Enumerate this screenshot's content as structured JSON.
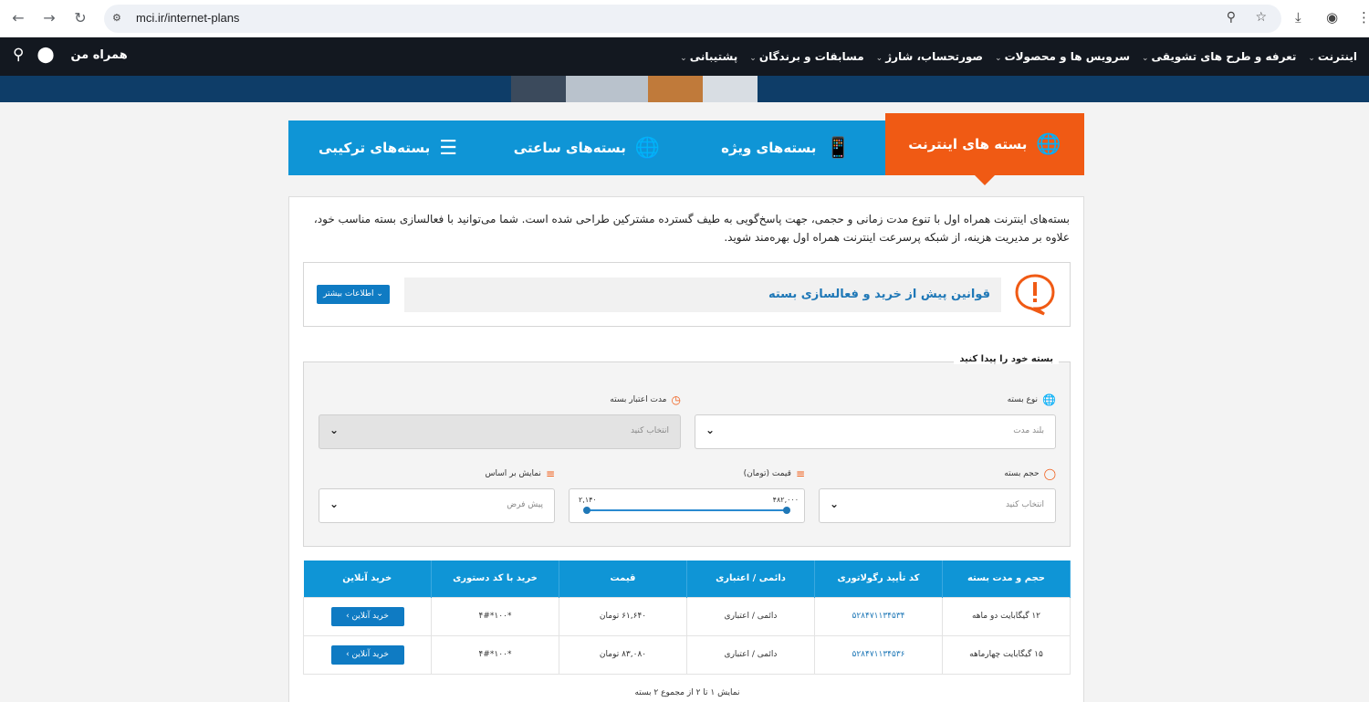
{
  "browser": {
    "url": "mci.ir/internet-plans"
  },
  "nav": {
    "items": [
      "اینترنت",
      "تعرفه و طرح های تشویقی",
      "سرویس ها و محصولات",
      "صورتحساب، شارژ",
      "مسابقات و برندگان",
      "پشتیبانی"
    ],
    "logo": "همراه من"
  },
  "tabs": [
    {
      "label": "بسته های اینترنت",
      "icon": "globe-icon",
      "active": true
    },
    {
      "label": "بسته‌های ویژه",
      "icon": "mobile-globe-icon",
      "active": false
    },
    {
      "label": "بسته‌های ساعتی",
      "icon": "clock-globe-icon",
      "active": false
    },
    {
      "label": "بسته‌های ترکیبی",
      "icon": "sliders-icon",
      "active": false
    }
  ],
  "intro": "بسته‌های اینترنت همراه اول با تنوع مدت زمانی و حجمی، جهت پاسخ‌گویی به طیف گسترده مشترکین طراحی شده است. شما می‌توانید با فعالسازی بسته مناسب خود، علاوه بر مدیریت هزینه، از شبکه پرسرعت اینترنت همراه اول بهره‌مند شوید.",
  "rules": {
    "title": "قوانین پیش از خرید و فعالسازی بسته",
    "more": "اطلاعات بیشتر ⌄"
  },
  "finder": {
    "legend": "بسته خود را پیدا کنید",
    "type_label": "نوع بسته",
    "type_value": "بلند مدت",
    "validity_label": "مدت اعتبار بسته",
    "validity_value": "انتخاب کنید",
    "volume_label": "حجم بسته",
    "volume_value": "انتخاب کنید",
    "price_label": "قیمت (تومان)",
    "price_min": "۲,۱۴۰",
    "price_max": "۴۸۲,۰۰۰",
    "sort_label": "نمایش بر اساس",
    "sort_value": "پیش فرض"
  },
  "table": {
    "headers": [
      "حجم و مدت بسته",
      "کد تأیید رگولاتوری",
      "دائمی / اعتباری",
      "قیمت",
      "خرید با کد دستوری",
      "خرید آنلاین"
    ],
    "rows": [
      {
        "package": "۱۲ گیگابایت دو ماهه",
        "code": "۵۲۸۴۷۱۱۳۴۵۳۴",
        "kind": "دائمی / اعتباری",
        "price": "۶۱,۶۴۰ تومان",
        "ussd": "*۱۰۰*۴#",
        "buy": "خرید آنلاین ›"
      },
      {
        "package": "۱۵ گیگابایت چهارماهه",
        "code": "۵۲۸۴۷۱۱۳۴۵۳۶",
        "kind": "دائمی / اعتباری",
        "price": "۸۳,۰۸۰ تومان",
        "ussd": "*۱۰۰*۴#",
        "buy": "خرید آنلاین ›"
      }
    ]
  },
  "pager": "نمایش ۱ تا ۲ از مجموع ۲ بسته"
}
